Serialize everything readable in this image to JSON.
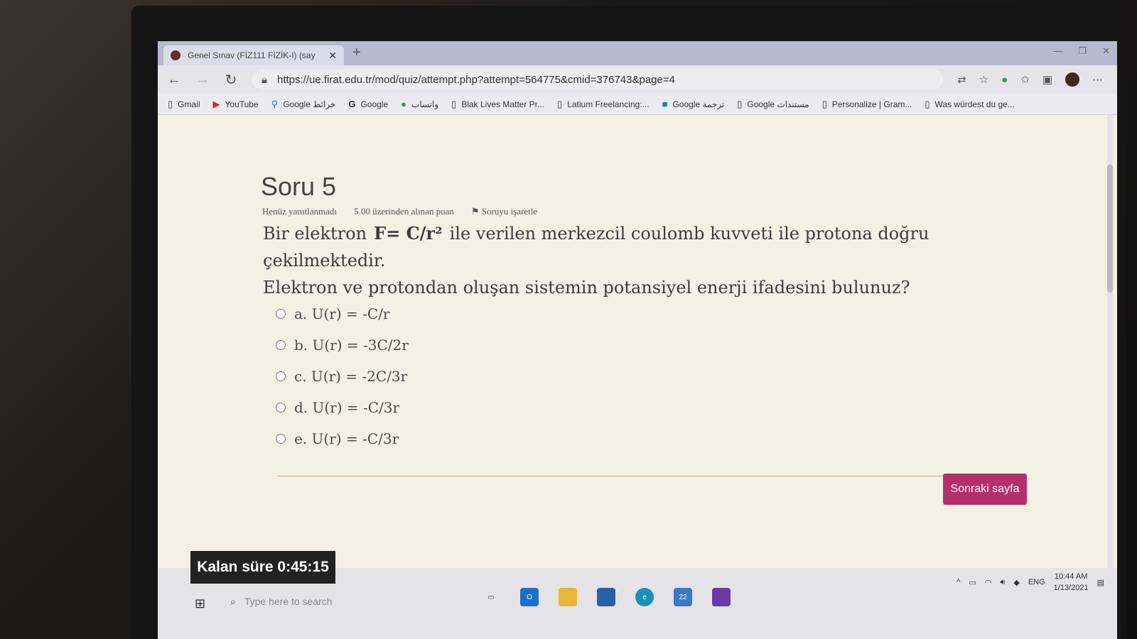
{
  "browser": {
    "tab_title": "Genel Sınav (FİZ111 FİZİK-I) (say",
    "tab_close": "✕",
    "new_tab": "+",
    "url": "https://ue.firat.edu.tr/mod/quiz/attempt.php?attempt=564775&cmid=376743&page=4",
    "bookmarks": [
      {
        "label": "Gmail",
        "icon": "page-icon"
      },
      {
        "label": "YouTube",
        "icon": "youtube-icon"
      },
      {
        "label": "Google خرائط",
        "icon": "maps-icon"
      },
      {
        "label": "Google",
        "icon": "google-icon"
      },
      {
        "label": "واتساب",
        "icon": "whatsapp-icon"
      },
      {
        "label": "Blak Lives Matter Pr...",
        "icon": "page-icon"
      },
      {
        "label": "Latium Freelancing:...",
        "icon": "page-icon"
      },
      {
        "label": "Google ترجمة",
        "icon": "translate-icon"
      },
      {
        "label": "Google مستندات",
        "icon": "page-icon"
      },
      {
        "label": "Personalize | Gram...",
        "icon": "page-icon"
      },
      {
        "label": "Was würdest du ge...",
        "icon": "page-icon"
      }
    ]
  },
  "quiz": {
    "question_title": "Soru 5",
    "status": "Henüz yanıtlanmadı",
    "points": "5.00 üzerinden alınan puan",
    "flag_label": "Soruyu işaretle",
    "text_part1": "Bir elektron",
    "formula": "F= C/r²",
    "text_part2": "ile verilen merkezcil coulomb kuvveti ile protona doğru çekilmektedir.",
    "text_line2": "Elektron ve protondan oluşan sistemin potansiyel enerji ifadesini bulunuz?",
    "options": [
      "a. U(r) = -C/r",
      "b. U(r) = -3C/2r",
      "c. U(r) = -2C/3r",
      "d. U(r) = -C/3r",
      "e. U(r) = -C/3r"
    ],
    "next_button": "Sonraki sayfa",
    "timer": "Kalan süre 0:45:15"
  },
  "taskbar": {
    "search_placeholder": "Type here to search",
    "language": "ENG",
    "time": "10:44 AM",
    "date": "1/13/2021",
    "mail_badge": "22"
  },
  "colors": {
    "accent_button": "#b4306a"
  }
}
